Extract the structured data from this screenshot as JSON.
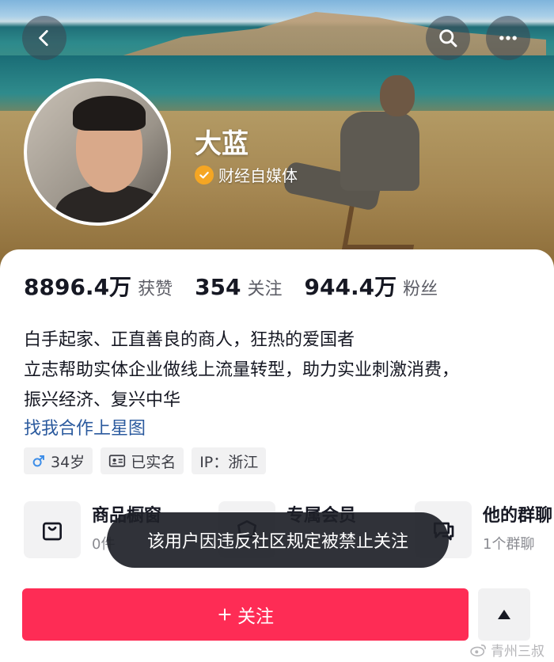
{
  "header": {
    "back_icon": "chevron-left-icon",
    "search_icon": "search-icon",
    "more_icon": "more-horizontal-icon"
  },
  "profile": {
    "name": "大蓝",
    "verification": {
      "icon": "verified-check-icon",
      "label": "财经自媒体",
      "color": "#f5a623"
    }
  },
  "stats": [
    {
      "value": "8896.4万",
      "label": "获赞"
    },
    {
      "value": "354",
      "label": "关注"
    },
    {
      "value": "944.4万",
      "label": "粉丝"
    }
  ],
  "bio": {
    "lines": [
      "白手起家、正直善良的商人，狂热的爱国者",
      "立志帮助实体企业做线上流量转型，助力实业刺激消费，",
      "振兴经济、复兴中华"
    ],
    "link": "找我合作上星图"
  },
  "tags": [
    {
      "icon": "male-icon",
      "text": "34岁"
    },
    {
      "icon": "id-card-icon",
      "text": "已实名"
    },
    {
      "icon": "",
      "text": "IP：浙江"
    }
  ],
  "features": [
    {
      "icon": "shopping-bag-icon",
      "title": "商品橱窗",
      "sub": "0件"
    },
    {
      "icon": "fan-club-icon",
      "title": "专属会员",
      "sub": ""
    },
    {
      "icon": "group-chat-icon",
      "title": "他的群聊",
      "sub": "1个群聊"
    }
  ],
  "toast": "该用户因违反社区规定被禁止关注",
  "actions": {
    "follow_label": "关注",
    "follow_color": "#fe2c55",
    "expand_icon": "triangle-up-icon"
  },
  "watermark": {
    "icon": "weibo-icon",
    "text": "青州三叔"
  }
}
